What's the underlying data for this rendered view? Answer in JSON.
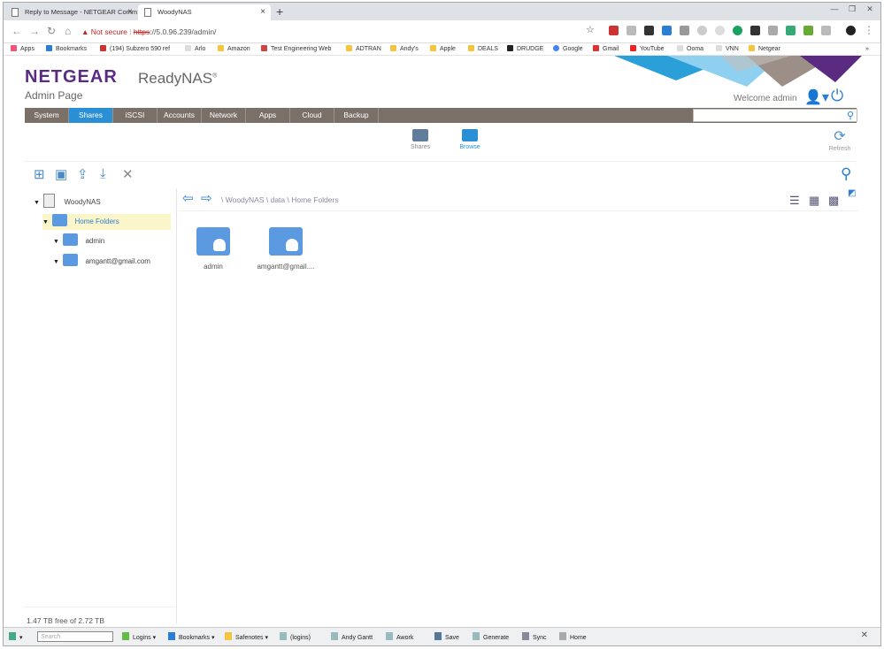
{
  "browser": {
    "tabs": [
      {
        "title": "Reply to Message - NETGEAR Comm",
        "close": "×"
      },
      {
        "title": "WoodyNAS",
        "close": "×"
      }
    ],
    "new_tab": "+",
    "window_controls": [
      "—",
      "❐",
      "✕"
    ],
    "security_label": "Not secure",
    "url_scheme": "https",
    "url_rest": "://5.0.96.239/admin/",
    "bookmarks": [
      "Apps",
      "Bookmarks",
      "(194) Subzero 590 ref",
      "Arlo",
      "Amazon",
      "Test Engineering Web",
      "ADTRAN",
      "Andy's",
      "Apple",
      "DEALS",
      "DRUDGE",
      "Google",
      "Gmail",
      "YouTube",
      "Ooma",
      "VNN",
      "Netgear"
    ],
    "bookmarks_more": "»"
  },
  "app": {
    "brand": "NETGEAR",
    "product": "ReadyNAS",
    "product_mark": "®",
    "page_title": "Admin Page",
    "welcome": "Welcome admin",
    "menu": [
      "System",
      "Shares",
      "iSCSI",
      "Accounts",
      "Network",
      "Apps",
      "Cloud",
      "Backup"
    ],
    "active_menu": "Shares",
    "subtabs": [
      "Shares",
      "Browse"
    ],
    "active_subtab": "Browse",
    "refresh_label": "Refresh"
  },
  "tree": {
    "root": "WoodyNAS",
    "selected": "Home Folders",
    "children": [
      "admin",
      "amgantt@gmail.com"
    ]
  },
  "storage": {
    "free_text": "1.47 TB free of 2.72 TB"
  },
  "browser_pane": {
    "breadcrumb": "\\ WoodyNAS \\ data \\ Home Folders",
    "items": [
      "admin",
      "amgantt@gmail...."
    ]
  },
  "bottom_toolbar": {
    "search_placeholder": "Search",
    "items": [
      "Logins",
      "Bookmarks",
      "Safenotes",
      "(logins)",
      "Andy Gantt",
      "Awork",
      "Save",
      "Generate",
      "Sync",
      "Home"
    ]
  }
}
